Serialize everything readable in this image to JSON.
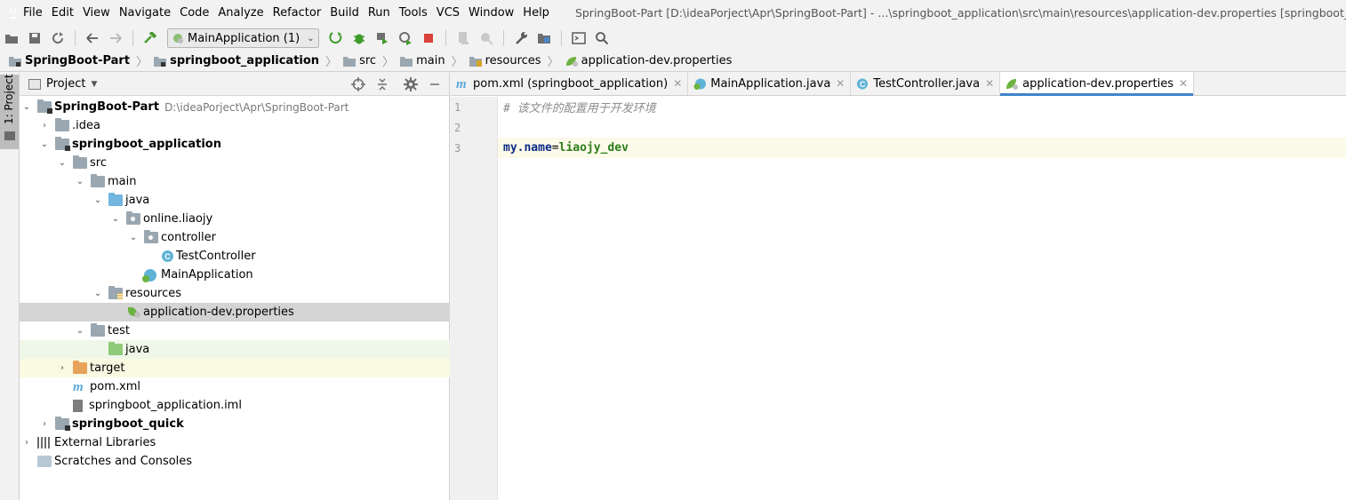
{
  "menubar": {
    "items": [
      "File",
      "Edit",
      "View",
      "Navigate",
      "Code",
      "Analyze",
      "Refactor",
      "Build",
      "Run",
      "Tools",
      "VCS",
      "Window",
      "Help"
    ],
    "window_title": "SpringBoot-Part [D:\\ideaPorject\\Apr\\SpringBoot-Part] - ...\\springboot_application\\src\\main\\resources\\application-dev.properties [springboot_application]"
  },
  "toolbar": {
    "run_config": "MainApplication (1)",
    "icons": [
      "open-folder-icon",
      "save-icon",
      "sync-icon",
      "back-icon",
      "forward-icon",
      "build-hammer-icon",
      "run-icon",
      "debug-icon",
      "coverage-icon",
      "profile-icon",
      "stop-icon",
      "device-icon",
      "attach-icon",
      "settings-wrench-icon",
      "project-structure-icon",
      "terminal-icon",
      "search-icon"
    ]
  },
  "breadcrumb": [
    "SpringBoot-Part",
    "springboot_application",
    "src",
    "main",
    "resources",
    "application-dev.properties"
  ],
  "left_strip": {
    "project_label": "1: Project"
  },
  "project_panel": {
    "title": "Project",
    "tree": [
      {
        "label": "SpringBoot-Part",
        "path": "D:\\ideaPorject\\Apr\\SpringBoot-Part"
      },
      {
        "label": ".idea"
      },
      {
        "label": "springboot_application"
      },
      {
        "label": "src"
      },
      {
        "label": "main"
      },
      {
        "label": "java"
      },
      {
        "label": "online.liaojy"
      },
      {
        "label": "controller"
      },
      {
        "label": "TestController"
      },
      {
        "label": "MainApplication"
      },
      {
        "label": "resources"
      },
      {
        "label": "application-dev.properties"
      },
      {
        "label": "test"
      },
      {
        "label": "java"
      },
      {
        "label": "target"
      },
      {
        "label": "pom.xml"
      },
      {
        "label": "springboot_application.iml"
      },
      {
        "label": "springboot_quick"
      },
      {
        "label": "External Libraries"
      },
      {
        "label": "Scratches and Consoles"
      }
    ]
  },
  "editor": {
    "tabs": [
      {
        "label": "pom.xml (springboot_application)"
      },
      {
        "label": "MainApplication.java"
      },
      {
        "label": "TestController.java"
      },
      {
        "label": "application-dev.properties"
      }
    ],
    "line_numbers": [
      "1",
      "2",
      "3"
    ],
    "lines": {
      "comment": "# 该文件的配置用于开发环境",
      "key": "my.name",
      "eq": "=",
      "value": "liaojy_dev"
    }
  }
}
